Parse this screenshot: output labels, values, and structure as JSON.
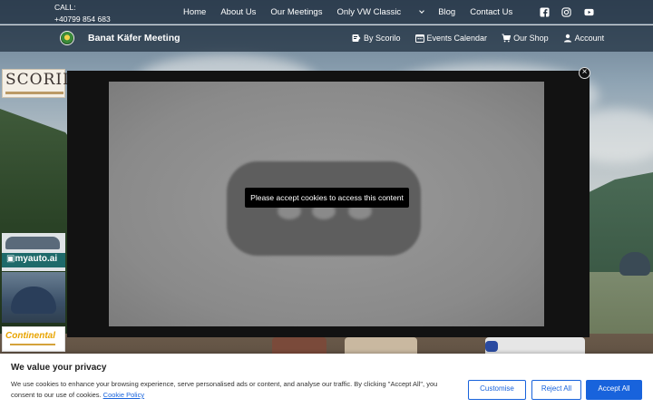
{
  "topbar": {
    "call_label": "CALL:",
    "phone": "+40799 854 683",
    "nav": [
      {
        "label": "Home"
      },
      {
        "label": "About Us"
      },
      {
        "label": "Our Meetings"
      },
      {
        "label": "Only VW Classic",
        "has_dropdown": true
      },
      {
        "label": "Blog"
      },
      {
        "label": "Contact Us"
      }
    ],
    "social_icons": [
      "facebook-icon",
      "instagram-icon",
      "youtube-icon"
    ]
  },
  "header": {
    "site_name": "Banat Käfer Meeting",
    "nav": [
      {
        "label": "By Scorilo",
        "icon": "tag-icon"
      },
      {
        "label": "Events Calendar",
        "icon": "calendar-icon"
      },
      {
        "label": "Our Shop",
        "icon": "cart-icon"
      },
      {
        "label": "Account",
        "icon": "user-icon"
      }
    ]
  },
  "sidebar_ads": {
    "scorilo": "SCORILO",
    "myauto": "myauto.ai",
    "continental": "Continental"
  },
  "modal": {
    "message": "Please accept cookies to access this content",
    "close_symbol": "×"
  },
  "cookie_banner": {
    "title": "We value your privacy",
    "text": "We use cookies to enhance your browsing experience, serve personalised ads or content, and analyse our traffic. By clicking \"Accept All\", you consent to our use of cookies.",
    "policy_link": "Cookie Policy",
    "buttons": {
      "customise": "Customise",
      "reject": "Reject All",
      "accept": "Accept All"
    }
  },
  "colors": {
    "accent": "#1863dc",
    "header_bg": "#1c2c3c"
  }
}
